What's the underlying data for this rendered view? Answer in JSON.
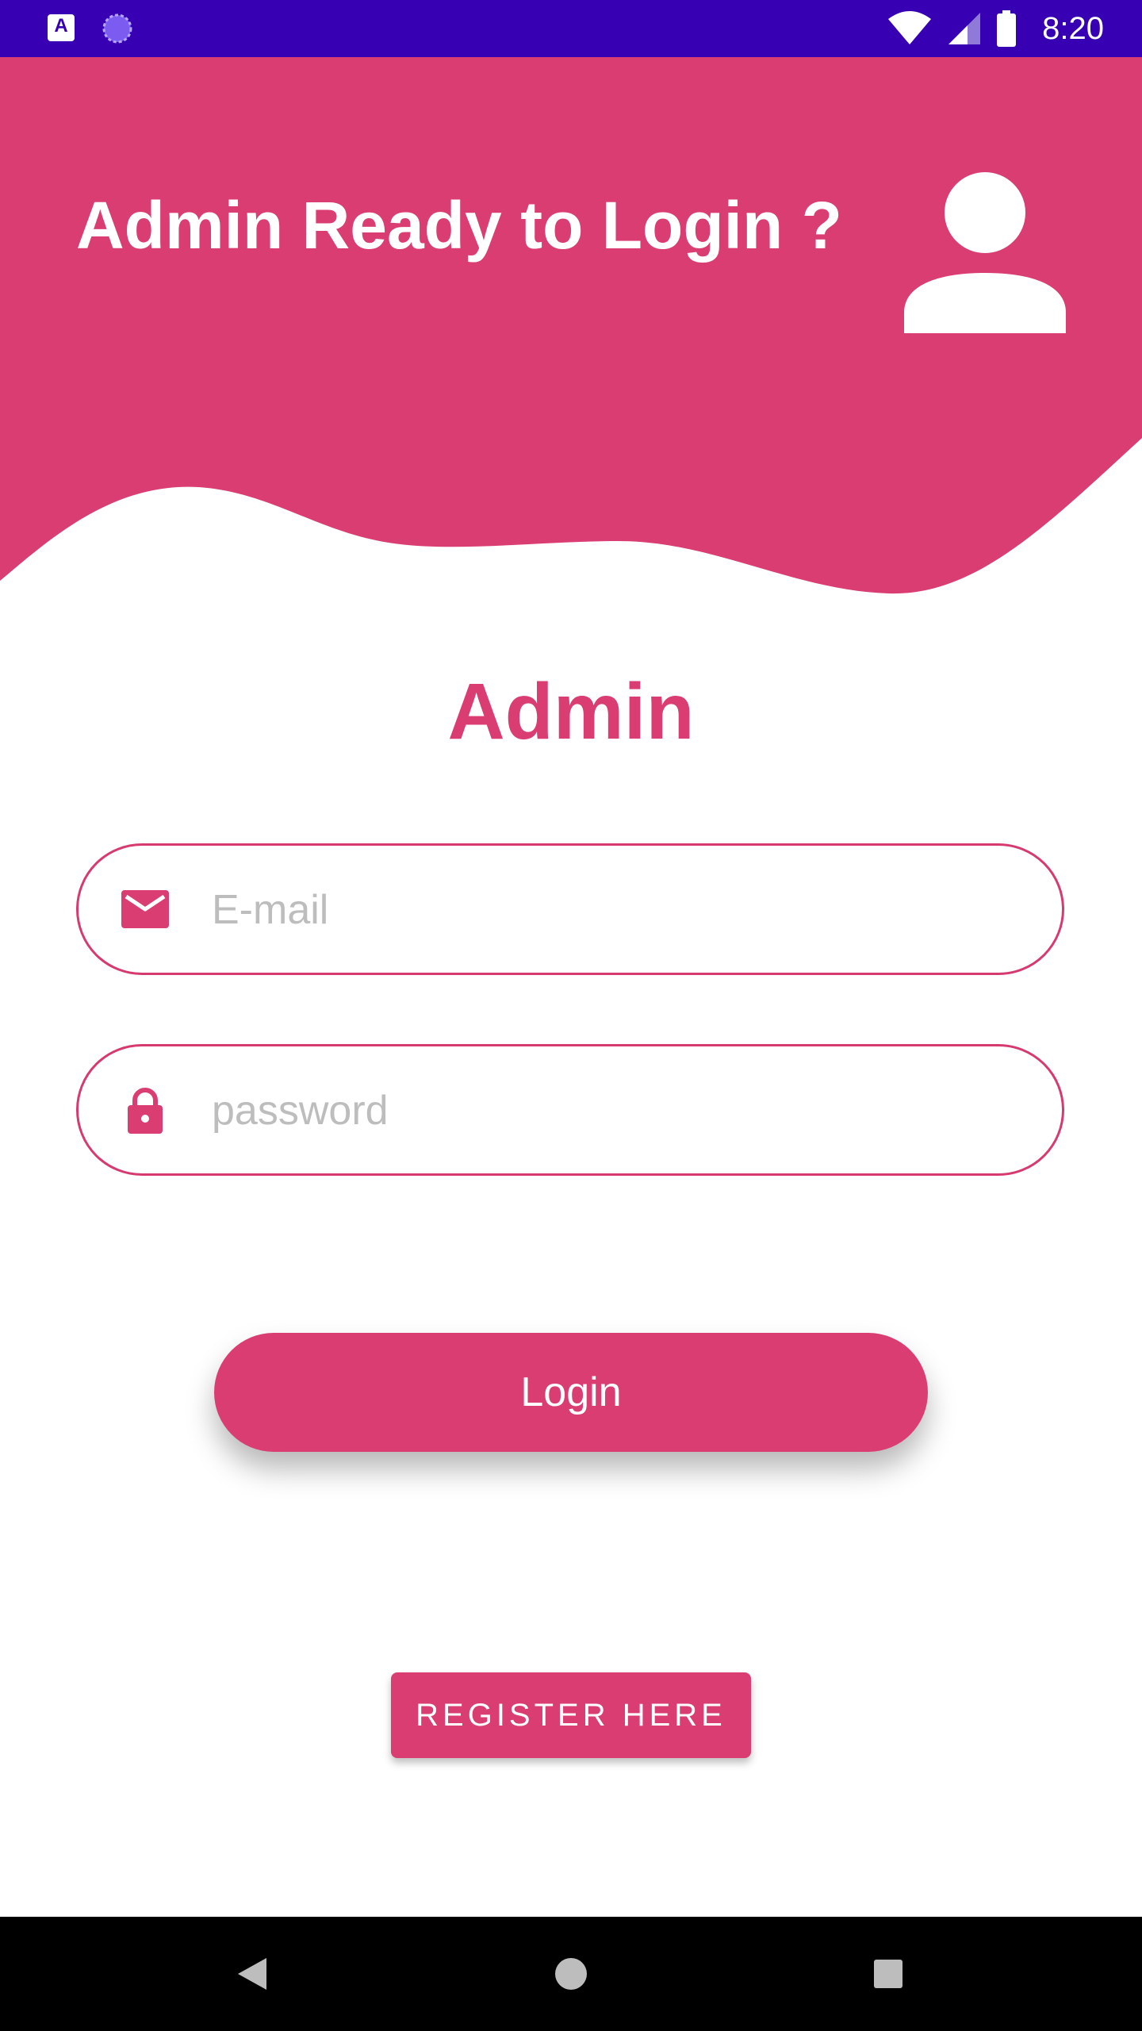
{
  "status_bar": {
    "time": "8:20",
    "left_icons": [
      "app-a-icon",
      "loading-circle-icon"
    ],
    "right_icons": [
      "wifi-icon",
      "signal-icon",
      "battery-icon"
    ],
    "app_icon_letter": "A"
  },
  "header": {
    "title": "Admin Ready to Login ?",
    "avatar_icon": "person-icon"
  },
  "form": {
    "title": "Admin",
    "email": {
      "placeholder": "E-mail",
      "value": "",
      "icon": "mail-icon"
    },
    "password": {
      "placeholder": "password",
      "value": "",
      "icon": "lock-icon"
    },
    "login_label": "Login",
    "register_label": "REGISTER HERE"
  },
  "nav_bar": {
    "buttons": [
      "back-icon",
      "home-icon",
      "recents-icon"
    ]
  },
  "colors": {
    "status_bar": "#3700b3",
    "accent": "#da3d72",
    "nav_bar": "#000000",
    "placeholder": "#bdbdbd"
  }
}
